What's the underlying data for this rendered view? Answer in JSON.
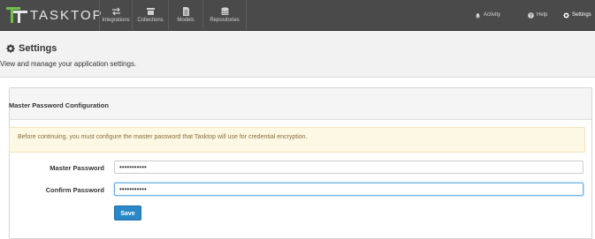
{
  "app": {
    "brand": "TASKTOP",
    "colors": {
      "topbar": "#4a4a4a",
      "accent": "#2a88c8",
      "alert_bg": "#fcf8e3",
      "alert_text": "#8a6d3b"
    }
  },
  "nav": {
    "items": [
      {
        "label": "Integrations",
        "icon": "arrows-swap-icon"
      },
      {
        "label": "Collections",
        "icon": "collection-icon"
      },
      {
        "label": "Models",
        "icon": "document-icon"
      },
      {
        "label": "Repositories",
        "icon": "database-icon"
      }
    ],
    "right": [
      {
        "label": "Activity",
        "icon": "bell-icon"
      },
      {
        "label": "Help",
        "icon": "question-circle-icon"
      },
      {
        "label": "Settings",
        "icon": "gear-icon"
      }
    ]
  },
  "page": {
    "title": "Settings",
    "subtitle": "View and manage your application settings."
  },
  "panel": {
    "title": "Master Password Configuration",
    "alert": "Before continuing, you must configure the master password that Tasktop will use for credential encryption.",
    "fields": [
      {
        "label": "Master Password",
        "value": "•••••••••••"
      },
      {
        "label": "Confirm Password",
        "value": "•••••••••••"
      }
    ],
    "save_label": "Save"
  }
}
